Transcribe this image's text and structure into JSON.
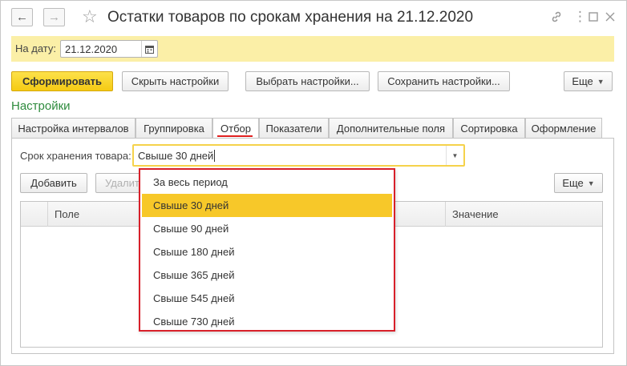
{
  "window": {
    "title": "Остатки товаров по срокам хранения на 21.12.2020",
    "back_icon": "arrow-left-icon",
    "forward_icon": "arrow-right-icon",
    "favorite_icon": "star-icon",
    "link_icon": "link-icon",
    "more_icon": "more-vertical-icon",
    "maximize_icon": "maximize-icon",
    "close_icon": "close-icon"
  },
  "date_bar": {
    "label": "На дату:",
    "value": "21.12.2020",
    "calendar_icon": "calendar-icon"
  },
  "toolbar": {
    "generate_label": "Сформировать",
    "hide_settings_label": "Скрыть настройки",
    "choose_settings_label": "Выбрать настройки...",
    "save_settings_label": "Сохранить настройки...",
    "more_label": "Еще"
  },
  "settings": {
    "title": "Настройки",
    "tabs": [
      {
        "label": "Настройка интервалов"
      },
      {
        "label": "Группировка"
      },
      {
        "label": "Отбор"
      },
      {
        "label": "Показатели"
      },
      {
        "label": "Дополнительные поля"
      },
      {
        "label": "Сортировка"
      },
      {
        "label": "Оформление"
      }
    ],
    "active_tab": "Отбор"
  },
  "filter": {
    "label": "Срок хранения товара:",
    "value": "Свыше 30 дней",
    "options": [
      {
        "label": "За весь период"
      },
      {
        "label": "Свыше 30 дней"
      },
      {
        "label": "Свыше 90 дней"
      },
      {
        "label": "Свыше 180 дней"
      },
      {
        "label": "Свыше 365 дней"
      },
      {
        "label": "Свыше 545 дней"
      },
      {
        "label": "Свыше 730 дней"
      }
    ],
    "selected_option": "Свыше 30 дней"
  },
  "table_toolbar": {
    "add_label": "Добавить",
    "delete_label": "Удалит",
    "more_label": "Еще"
  },
  "table": {
    "columns": [
      "Поле",
      "Значение"
    ]
  },
  "colors": {
    "accent_yellow": "#f5cb13",
    "date_band": "#fbefa7",
    "section_title": "#2e8b3d",
    "highlight_red": "#d8202a",
    "selected_option": "#f7c829"
  }
}
